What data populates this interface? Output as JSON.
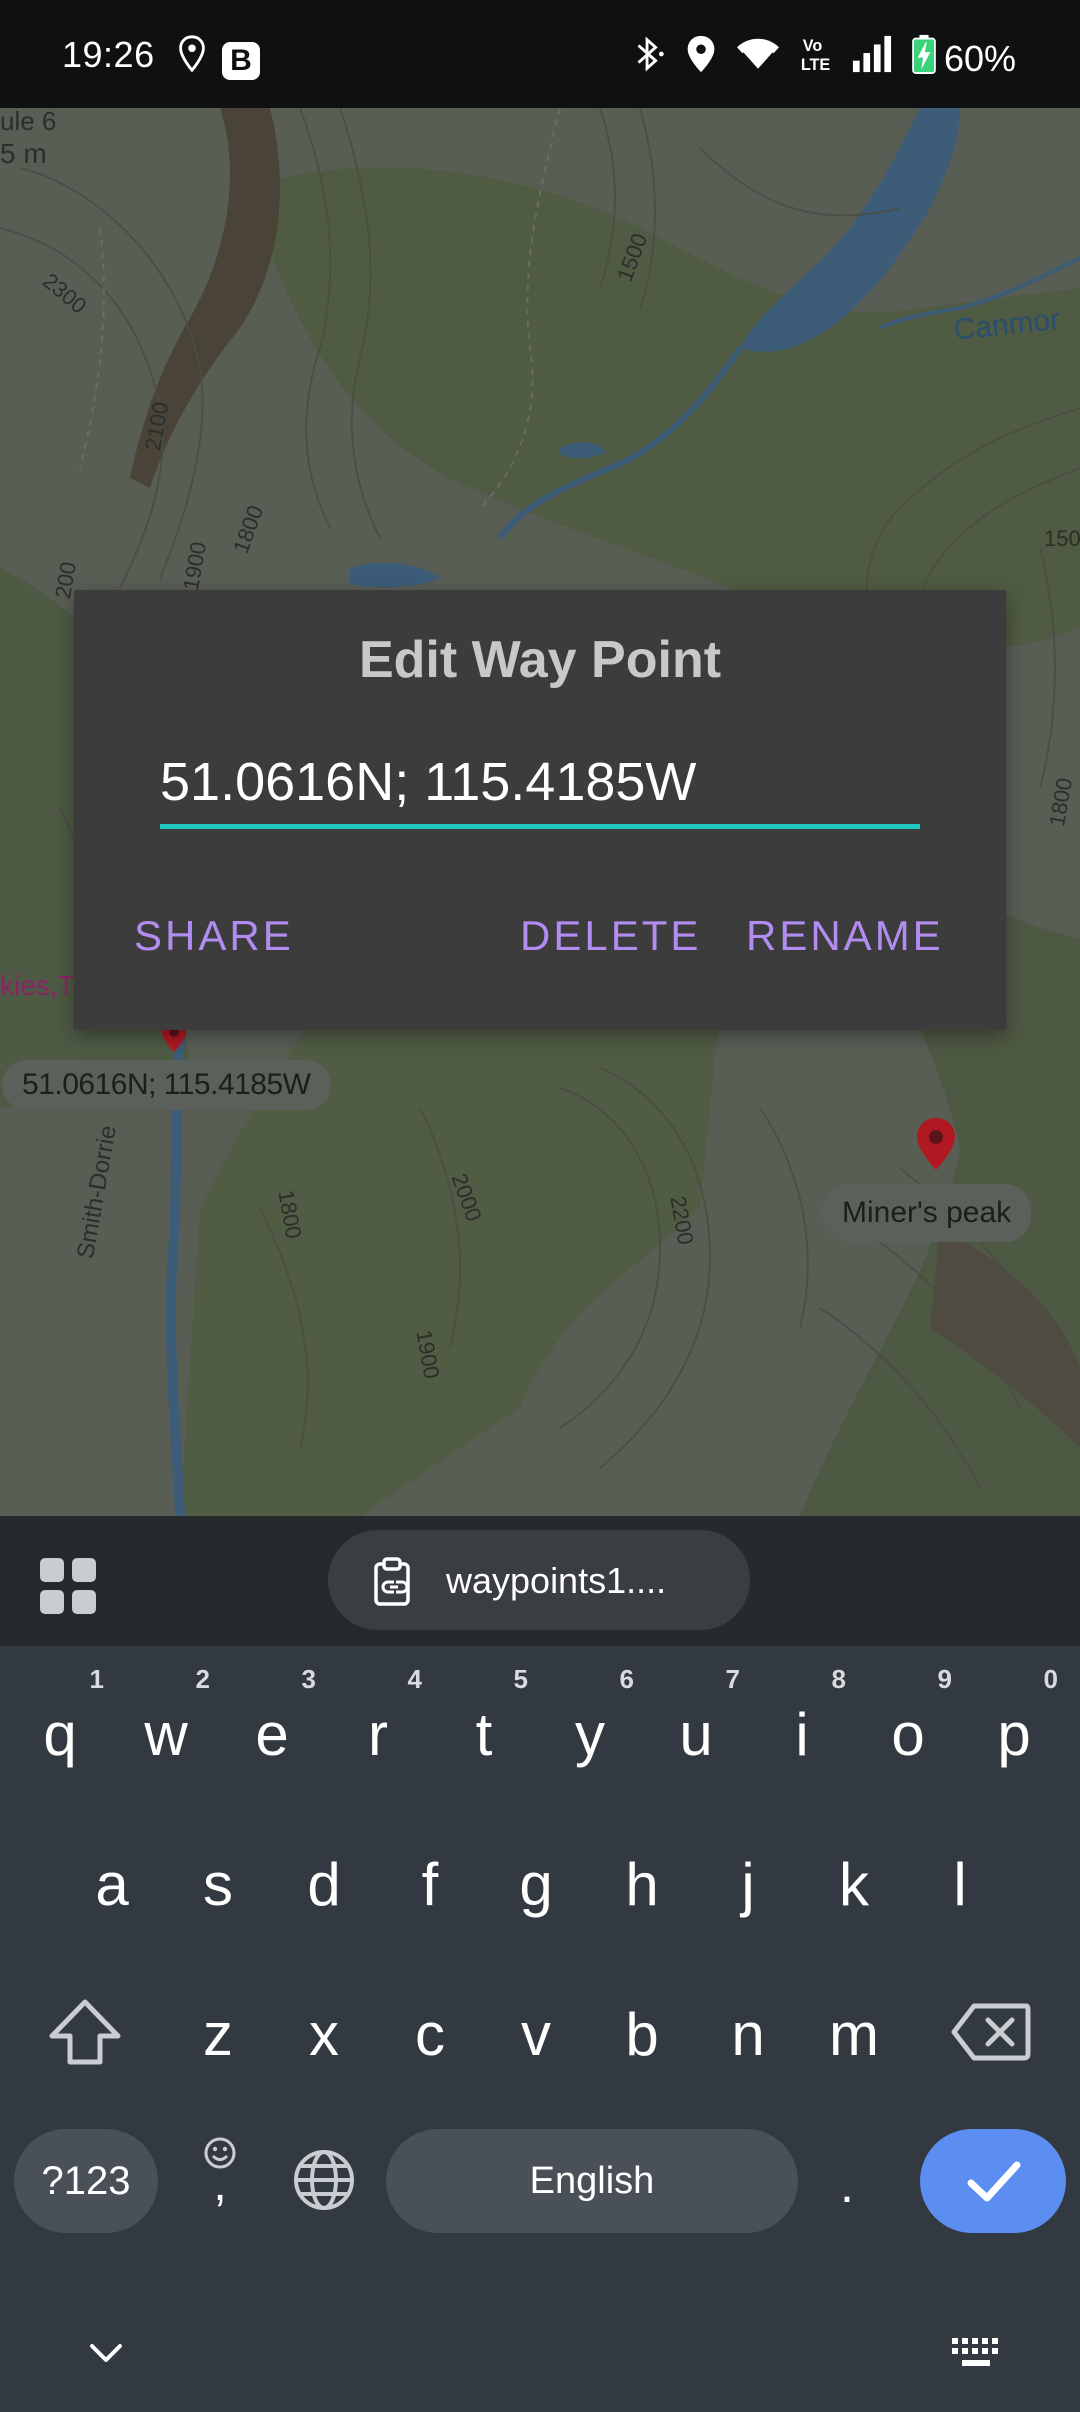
{
  "status_bar": {
    "time": "19:26",
    "left_icons": [
      "location-pin-icon",
      "b-app-icon"
    ],
    "b_icon_letter": "B",
    "right_icons": [
      "bluetooth-icon",
      "location-icon",
      "wifi-icon",
      "volte-icon",
      "signal-icon",
      "battery-charging-icon"
    ],
    "volte_text": "Vo LTE",
    "battery": "60%"
  },
  "map": {
    "labels": [
      "ule 6",
      "5 m",
      "2300",
      "2100",
      "1900",
      "1800",
      "200",
      "1500",
      "Canmor",
      "150",
      "1800",
      "kies,Tr",
      "Smith-Dorrie",
      "1800",
      "2000",
      "2200",
      "1900"
    ],
    "waypoint_chip": "51.0616N; 115.4185W",
    "peak_chip": "Miner's peak",
    "colors": {
      "water": "#3c5c78",
      "route": "#b2247a",
      "pin": "#b01822"
    }
  },
  "dialog": {
    "title": "Edit Way Point",
    "input_value": "51.0616N; 115.4185W",
    "share": "SHARE",
    "delete": "DELETE",
    "rename": "RENAME",
    "accent_color": "#1ec8c0",
    "button_color": "#b28cf0"
  },
  "keyboard": {
    "toolbar": {
      "apps_icon": "apps-grid-icon",
      "clipboard_icon": "clipboard-link-icon",
      "clipboard_text": "waypoints1...."
    },
    "row1": [
      {
        "k": "q",
        "h": "1"
      },
      {
        "k": "w",
        "h": "2"
      },
      {
        "k": "e",
        "h": "3"
      },
      {
        "k": "r",
        "h": "4"
      },
      {
        "k": "t",
        "h": "5"
      },
      {
        "k": "y",
        "h": "6"
      },
      {
        "k": "u",
        "h": "7"
      },
      {
        "k": "i",
        "h": "8"
      },
      {
        "k": "o",
        "h": "9"
      },
      {
        "k": "p",
        "h": "0"
      }
    ],
    "row2": [
      "a",
      "s",
      "d",
      "f",
      "g",
      "h",
      "j",
      "k",
      "l"
    ],
    "row3": [
      "z",
      "x",
      "c",
      "v",
      "b",
      "n",
      "m"
    ],
    "symbols": "?123",
    "emoji_comma": ",",
    "space": "English",
    "period": ".",
    "enter_icon": "check-icon",
    "hide_icon": "chevron-down-icon",
    "keyboard_icon": "keyboard-icon",
    "colors": {
      "background": "#333941",
      "enter": "#5b8ef0"
    }
  }
}
